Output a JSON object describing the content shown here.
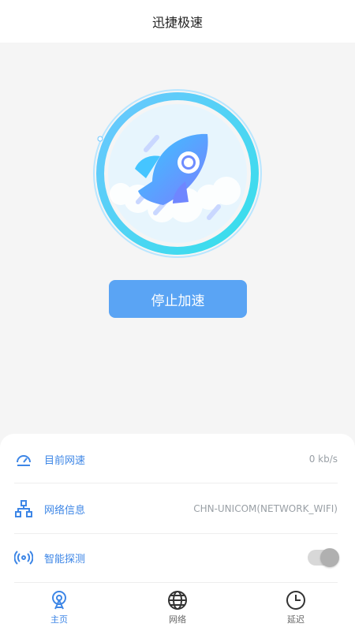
{
  "header": {
    "title": "迅捷极速"
  },
  "main": {
    "action_label": "停止加速"
  },
  "info": {
    "rows": [
      {
        "label": "目前网速",
        "value": "0 kb/s",
        "icon": "speedometer-icon"
      },
      {
        "label": "网络信息",
        "value": "CHN-UNICOM(NETWORK_WIFI)",
        "icon": "network-tree-icon"
      },
      {
        "label": "智能探测",
        "toggle": "on",
        "icon": "radar-wave-icon"
      }
    ]
  },
  "tabs": [
    {
      "label": "主页",
      "icon": "home-radar-icon",
      "active": true
    },
    {
      "label": "网络",
      "icon": "globe-icon",
      "active": false
    },
    {
      "label": "延迟",
      "icon": "clock-icon",
      "active": false
    }
  ],
  "colors": {
    "accent": "#3d86e6",
    "button": "#5aa4f4",
    "ring": "#4fd3f0"
  }
}
